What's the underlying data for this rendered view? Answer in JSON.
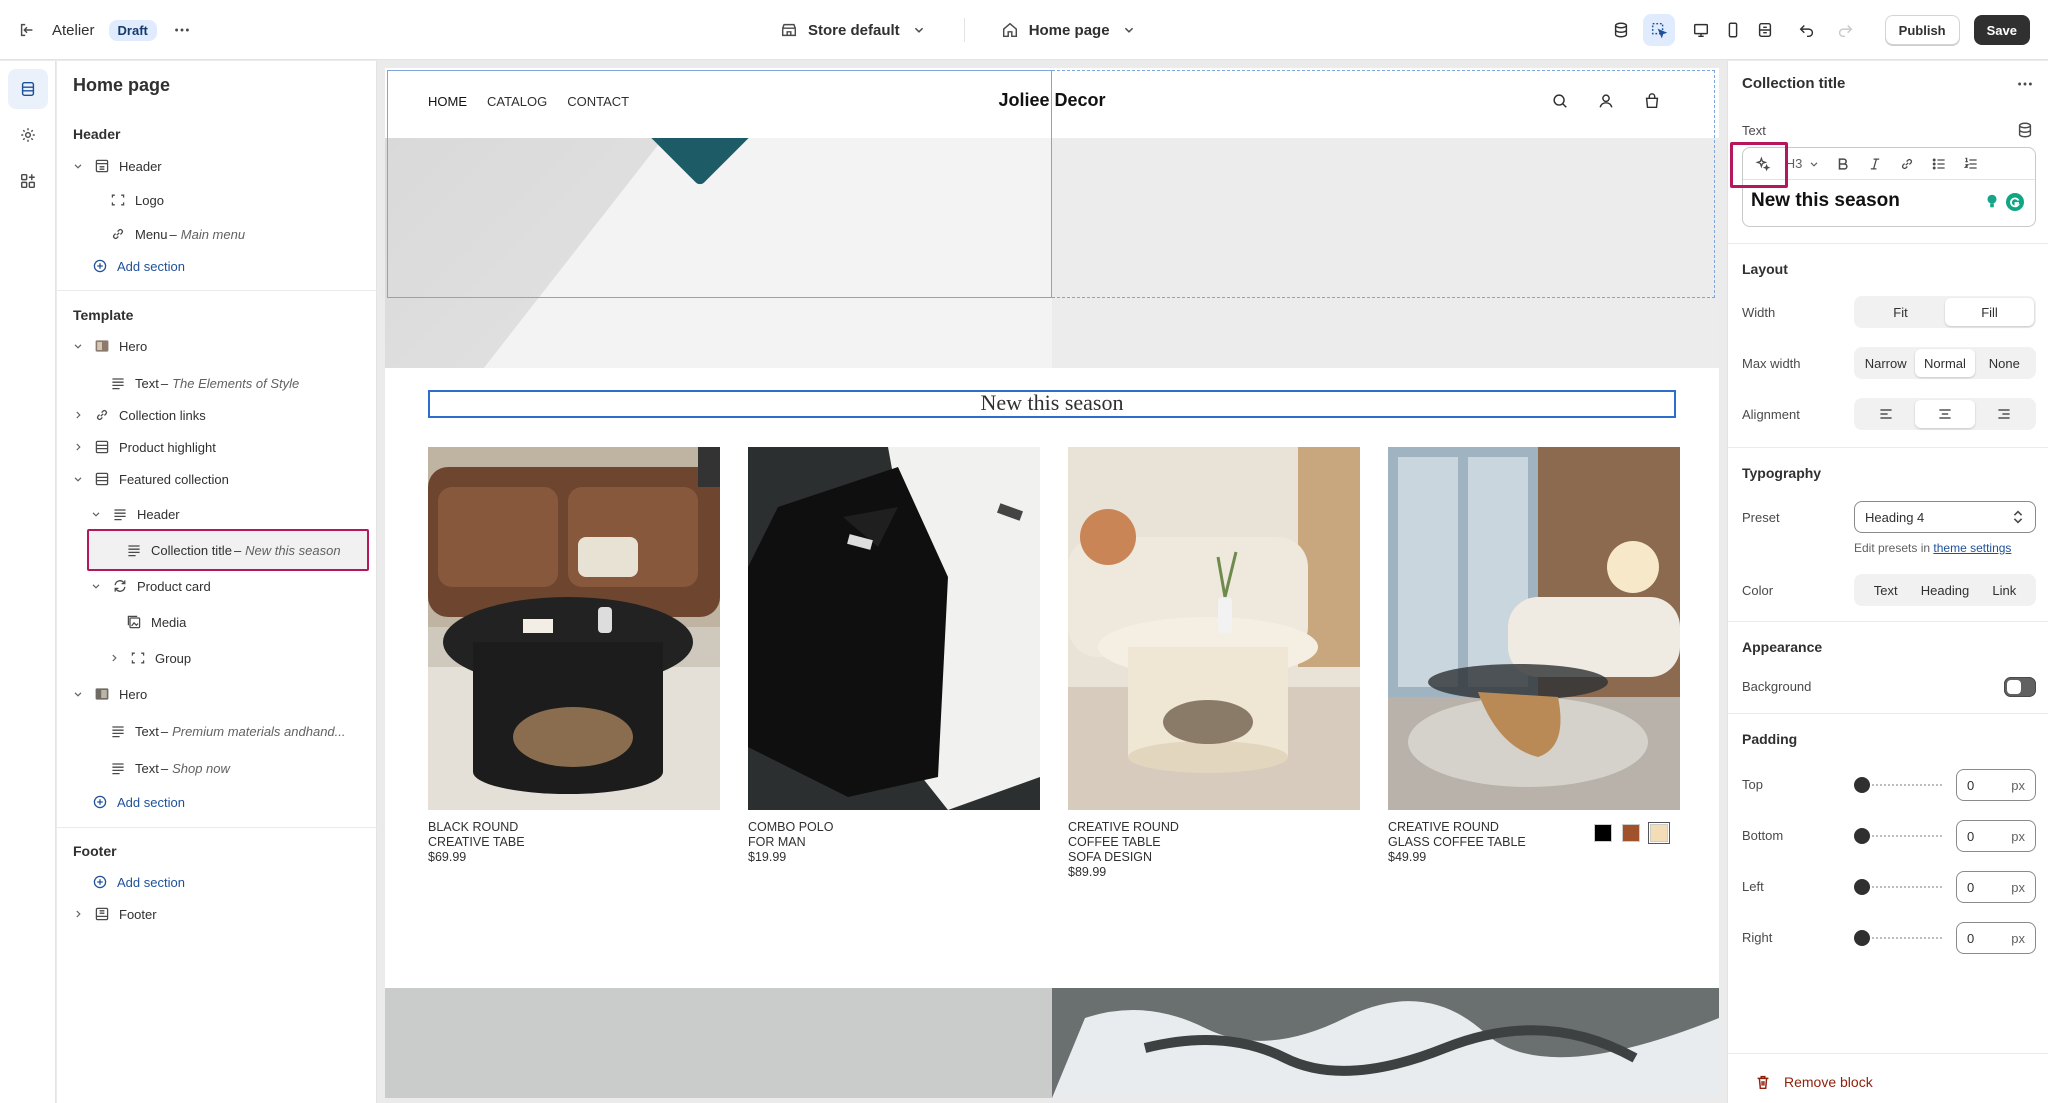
{
  "topbar": {
    "store_name": "Atelier",
    "draft_badge": "Draft",
    "theme_picker": "Store default",
    "page_picker": "Home page",
    "publish_label": "Publish",
    "save_label": "Save"
  },
  "layers": {
    "page_title": "Home page",
    "header_group": {
      "label": "Header",
      "items": [
        {
          "label": "Header"
        },
        {
          "label": "Logo"
        },
        {
          "label": "Menu",
          "sub": "Main menu"
        }
      ],
      "add_section": "Add section"
    },
    "template_group": {
      "label": "Template",
      "hero": {
        "label": "Hero",
        "text": "Text",
        "text_sub": "The Elements of Style"
      },
      "collection_links": "Collection links",
      "product_highlight": "Product highlight",
      "featured_collection": "Featured collection",
      "fc_header": "Header",
      "collection_title": "Collection title",
      "collection_title_sub": "New this season",
      "product_card": "Product card",
      "media": "Media",
      "group": "Group",
      "hero2": {
        "label": "Hero",
        "text1": "Text",
        "text1_sub": "Premium materials andhand...",
        "text2": "Text",
        "text2_sub": "Shop now"
      },
      "add_section": "Add section"
    },
    "footer_group": {
      "label": "Footer",
      "add_section": "Add section",
      "footer": "Footer"
    }
  },
  "preview": {
    "nav": [
      "HOME",
      "CATALOG",
      "CONTACT"
    ],
    "brand": "Joliee Decor",
    "collection_title": "New this season",
    "products": [
      {
        "name": "BLACK ROUND\nCREATIVE TABE",
        "price": "$69.99"
      },
      {
        "name": "COMBO POLO\nFOR MAN",
        "price": "$19.99"
      },
      {
        "name": "CREATIVE ROUND\nCOFFEE TABLE\nSOFA DESIGN",
        "price": "$89.99"
      },
      {
        "name": "CREATIVE ROUND\nGLASS COFFEE TABLE",
        "price": "$49.99"
      }
    ],
    "swatch_colors": [
      "#000000",
      "#a0522d",
      "#f3ddb6"
    ]
  },
  "props": {
    "title": "Collection title",
    "text_label": "Text",
    "heading_level": "H3",
    "text_value": "New this season",
    "layout": {
      "section": "Layout",
      "width_label": "Width",
      "width_options": [
        "Fit",
        "Fill"
      ],
      "max_width_label": "Max width",
      "max_width_options": [
        "Narrow",
        "Normal",
        "None"
      ],
      "alignment_label": "Alignment"
    },
    "typography": {
      "section": "Typography",
      "preset_label": "Preset",
      "preset_value": "Heading 4",
      "edit_presets_prefix": "Edit presets in",
      "theme_settings_link": "theme settings",
      "color_label": "Color",
      "color_options": [
        "Text",
        "Heading",
        "Link"
      ]
    },
    "appearance": {
      "section": "Appearance",
      "background_label": "Background"
    },
    "padding": {
      "section": "Padding",
      "top_label": "Top",
      "top_value": "0",
      "bottom_label": "Bottom",
      "bottom_value": "0",
      "left_label": "Left",
      "left_value": "0",
      "right_label": "Right",
      "right_value": "0",
      "unit": "px"
    },
    "remove_block": "Remove block"
  }
}
